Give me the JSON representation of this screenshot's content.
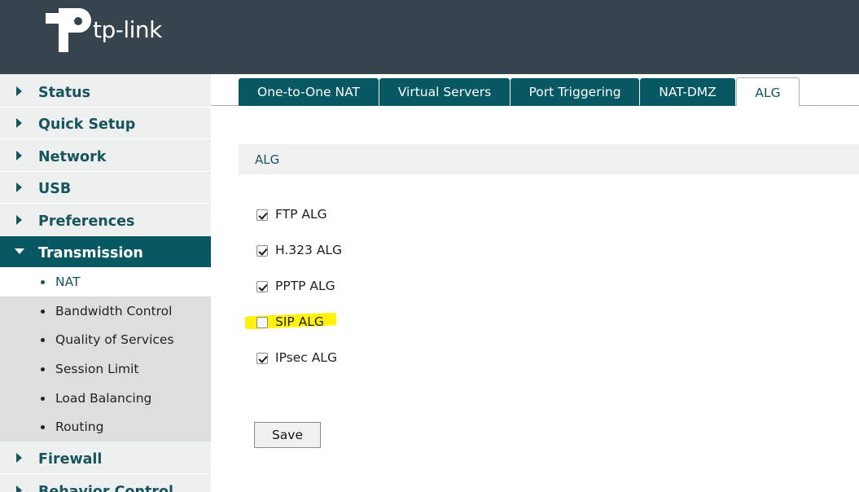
{
  "brand": {
    "logo_text": "tp-link"
  },
  "sidebar": {
    "items": [
      {
        "label": "Status"
      },
      {
        "label": "Quick Setup"
      },
      {
        "label": "Network"
      },
      {
        "label": "USB"
      },
      {
        "label": "Preferences"
      },
      {
        "label": "Transmission"
      }
    ],
    "subitems": [
      {
        "label": "NAT"
      },
      {
        "label": "Bandwidth Control"
      },
      {
        "label": "Quality of Services"
      },
      {
        "label": "Session Limit"
      },
      {
        "label": "Load Balancing"
      },
      {
        "label": "Routing"
      }
    ],
    "items_after": [
      {
        "label": "Firewall"
      },
      {
        "label": "Behavior Control"
      }
    ]
  },
  "tabs": [
    {
      "label": "One-to-One NAT"
    },
    {
      "label": "Virtual Servers"
    },
    {
      "label": "Port Triggering"
    },
    {
      "label": "NAT-DMZ"
    },
    {
      "label": "ALG"
    }
  ],
  "section": {
    "title": "ALG"
  },
  "options": [
    {
      "label": "FTP ALG",
      "checked": true
    },
    {
      "label": "H.323 ALG",
      "checked": true
    },
    {
      "label": "PPTP ALG",
      "checked": true
    },
    {
      "label": "SIP ALG",
      "checked": false
    },
    {
      "label": "IPsec ALG",
      "checked": true
    }
  ],
  "actions": {
    "save_label": "Save"
  },
  "colors": {
    "header_bg": "#36454d",
    "accent": "#075863",
    "highlight": "#fff200"
  }
}
